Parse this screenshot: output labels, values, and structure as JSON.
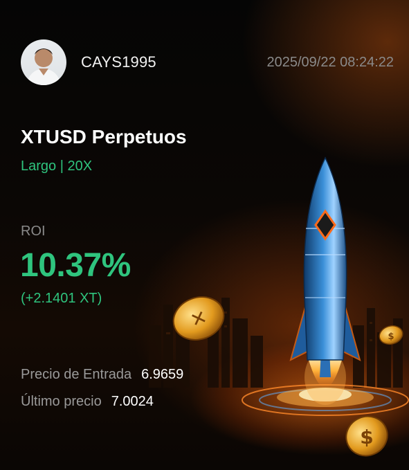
{
  "header": {
    "username": "CAYS1995",
    "timestamp": "2025/09/22 08:24:22"
  },
  "position": {
    "pair": "XTUSD Perpetuos",
    "side_leverage": "Largo | 20X"
  },
  "roi": {
    "label": "ROI",
    "value": "10.37%",
    "pnl": "(+2.1401 XT)"
  },
  "prices": {
    "entry_label": "Precio de Entrada",
    "entry_value": "6.9659",
    "last_label": "Último precio",
    "last_value": "7.0024"
  },
  "colors": {
    "accent_green": "#2fc47e",
    "muted_gray": "#8a8a8a",
    "glow_orange": "#ff7a1a"
  },
  "icons": [
    "avatar",
    "rocket-illustration",
    "coin-icon"
  ]
}
